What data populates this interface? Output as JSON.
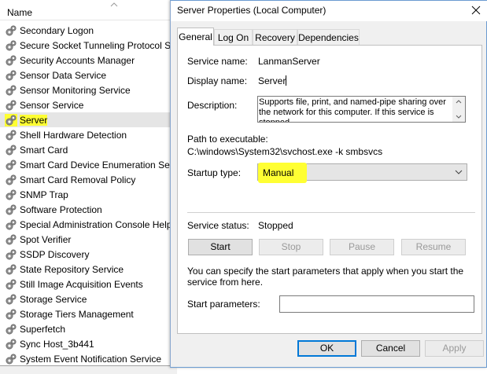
{
  "services_list": {
    "column_header": "Name",
    "rows": [
      "Secondary Logon",
      "Secure Socket Tunneling Protocol Service",
      "Security Accounts Manager",
      "Sensor Data Service",
      "Sensor Monitoring Service",
      "Sensor Service",
      "Server",
      "Shell Hardware Detection",
      "Smart Card",
      "Smart Card Device Enumeration Service",
      "Smart Card Removal Policy",
      "SNMP Trap",
      "Software Protection",
      "Special Administration Console Helper",
      "Spot Verifier",
      "SSDP Discovery",
      "State Repository Service",
      "Still Image Acquisition Events",
      "Storage Service",
      "Storage Tiers Management",
      "Superfetch",
      "Sync Host_3b441",
      "System Event Notification Service"
    ],
    "selected_row": "Server",
    "icon": "gear-icon"
  },
  "dialog": {
    "title": "Server Properties (Local Computer)",
    "tabs": [
      "General",
      "Log On",
      "Recovery",
      "Dependencies"
    ],
    "active_tab": "General",
    "service_name_label": "Service name:",
    "service_name_value": "LanmanServer",
    "display_name_label": "Display name:",
    "display_name_value": "Server",
    "description_label": "Description:",
    "description_value": "Supports file, print, and named-pipe sharing over the network for this computer. If this service is stopped,",
    "path_label": "Path to executable:",
    "path_value": "C:\\windows\\System32\\svchost.exe -k smbsvcs",
    "startup_type_label": "Startup type:",
    "startup_type_value": "Manual",
    "service_status_label": "Service status:",
    "service_status_value": "Stopped",
    "buttons": {
      "start": "Start",
      "stop": "Stop",
      "pause": "Pause",
      "resume": "Resume"
    },
    "start_params_hint": "You can specify the start parameters that apply when you start the service from here.",
    "start_params_label": "Start parameters:",
    "start_params_value": "",
    "footer": {
      "ok": "OK",
      "cancel": "Cancel",
      "apply": "Apply"
    },
    "highlight_color": "#ffff33",
    "accent_color": "#0078d7"
  }
}
